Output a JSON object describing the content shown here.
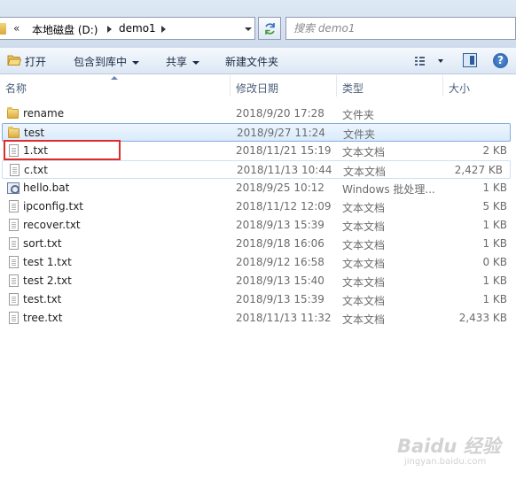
{
  "address_bar": {
    "overflow_chevron": "«",
    "breadcrumbs": [
      "本地磁盘 (D:)",
      "demo1"
    ]
  },
  "search": {
    "placeholder": "搜索 demo1"
  },
  "toolbar": {
    "open": "打开",
    "include_in_library": "包含到库中",
    "share": "共享",
    "new_folder": "新建文件夹",
    "help": "?"
  },
  "columns": {
    "name": "名称",
    "date": "修改日期",
    "type": "类型",
    "size": "大小"
  },
  "files": [
    {
      "name": "rename",
      "date": "2018/9/20 17:28",
      "type": "文件夹",
      "size": "",
      "icon": "folder-icon"
    },
    {
      "name": "test",
      "date": "2018/9/27 11:24",
      "type": "文件夹",
      "size": "",
      "icon": "folder-icon"
    },
    {
      "name": "1.txt",
      "date": "2018/11/21 15:19",
      "type": "文本文档",
      "size": "2 KB",
      "icon": "text-file-icon"
    },
    {
      "name": "c.txt",
      "date": "2018/11/13 10:44",
      "type": "文本文档",
      "size": "2,427 KB",
      "icon": "text-file-icon"
    },
    {
      "name": "hello.bat",
      "date": "2018/9/25 10:12",
      "type": "Windows 批处理...",
      "size": "1 KB",
      "icon": "batch-file-icon"
    },
    {
      "name": "ipconfig.txt",
      "date": "2018/11/12 12:09",
      "type": "文本文档",
      "size": "5 KB",
      "icon": "text-file-icon"
    },
    {
      "name": "recover.txt",
      "date": "2018/9/13 15:39",
      "type": "文本文档",
      "size": "1 KB",
      "icon": "text-file-icon"
    },
    {
      "name": "sort.txt",
      "date": "2018/9/18 16:06",
      "type": "文本文档",
      "size": "1 KB",
      "icon": "text-file-icon"
    },
    {
      "name": "test 1.txt",
      "date": "2018/9/12 16:58",
      "type": "文本文档",
      "size": "0 KB",
      "icon": "text-file-icon"
    },
    {
      "name": "test 2.txt",
      "date": "2018/9/13 15:40",
      "type": "文本文档",
      "size": "1 KB",
      "icon": "text-file-icon"
    },
    {
      "name": "test.txt",
      "date": "2018/9/13 15:39",
      "type": "文本文档",
      "size": "1 KB",
      "icon": "text-file-icon"
    },
    {
      "name": "tree.txt",
      "date": "2018/11/13 11:32",
      "type": "文本文档",
      "size": "2,433 KB",
      "icon": "text-file-icon"
    }
  ],
  "watermark": {
    "line1": "Baidu 经验",
    "line2": "jingyan.baidu.com"
  },
  "colors": {
    "highlight_box": "#e22a2a",
    "selection": "#d9ebfc",
    "toolbar": "#dce7f4"
  }
}
